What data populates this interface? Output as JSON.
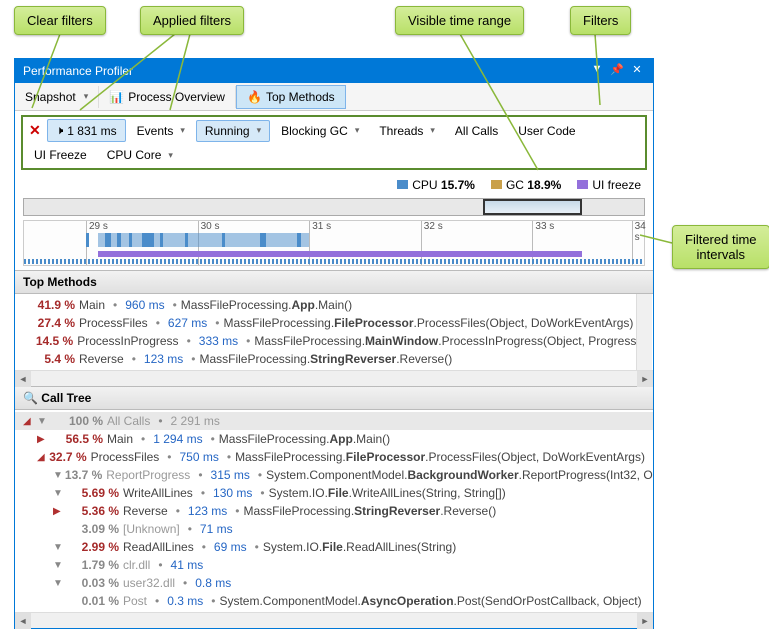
{
  "callouts": {
    "clear_filters": "Clear filters",
    "applied_filters": "Applied filters",
    "visible_time_range": "Visible time range",
    "filters": "Filters",
    "filtered_time_intervals": "Filtered time\nintervals"
  },
  "window": {
    "title": "Performance Profiler"
  },
  "tabs": {
    "snapshot": "Snapshot",
    "process_overview": "Process Overview",
    "top_methods": "Top Methods"
  },
  "filters": {
    "time_ms": "1 831 ms",
    "events": "Events",
    "running": "Running",
    "blocking_gc": "Blocking GC",
    "threads": "Threads",
    "all_calls": "All Calls",
    "user_code": "User Code",
    "ui_freeze": "UI Freeze",
    "cpu_core": "CPU Core"
  },
  "legend": {
    "cpu_label": "CPU",
    "cpu_value": "15.7%",
    "gc_label": "GC",
    "gc_value": "18.9%",
    "ui_freeze": "UI freeze"
  },
  "timeline": {
    "ticks": [
      "29 s",
      "30 s",
      "31 s",
      "32 s",
      "33 s",
      "34 s"
    ]
  },
  "sections": {
    "top_methods": "Top Methods",
    "call_tree": "Call Tree"
  },
  "top_methods": [
    {
      "pct": "41.9 %",
      "name": "Main",
      "ms": "960 ms",
      "path": "MassFileProcessing.<b>App</b>.Main()"
    },
    {
      "pct": "27.4 %",
      "name": "ProcessFiles",
      "ms": "627 ms",
      "path": "MassFileProcessing.<b>FileProcessor</b>.ProcessFiles(Object, DoWorkEventArgs)"
    },
    {
      "pct": "14.5 %",
      "name": "ProcessInProgress",
      "ms": "333 ms",
      "path": "MassFileProcessing.<b>MainWindow</b>.ProcessInProgress(Object, ProgressC"
    },
    {
      "pct": "5.4 %",
      "name": "Reverse",
      "ms": "123 ms",
      "path": "MassFileProcessing.<b>StringReverser</b>.Reverse()"
    }
  ],
  "call_tree_header": {
    "pct": "100 %",
    "label": "All Calls",
    "ms": "2 291 ms"
  },
  "call_tree": [
    {
      "indent": 1,
      "glyph": "▶",
      "glyphRed": true,
      "pct": "56.5 %",
      "name": "Main",
      "ms": "1 294 ms",
      "path": "MassFileProcessing.<b>App</b>.Main()"
    },
    {
      "indent": 1,
      "glyph": "◢",
      "glyphRed": true,
      "pct": "32.7 %",
      "name": "ProcessFiles",
      "ms": "750 ms",
      "path": "MassFileProcessing.<b>FileProcessor</b>.ProcessFiles(Object, DoWorkEventArgs)"
    },
    {
      "indent": 2,
      "glyph": "▼",
      "pct": "13.7 %",
      "gray": true,
      "name": "ReportProgress",
      "ms": "315 ms",
      "path": "System.ComponentModel.<b>BackgroundWorker</b>.ReportProgress(Int32, O"
    },
    {
      "indent": 2,
      "glyph": "▼",
      "pct": "5.69 %",
      "name": "WriteAllLines",
      "ms": "130 ms",
      "path": "System.IO.<b>File</b>.WriteAllLines(String, String[])"
    },
    {
      "indent": 2,
      "glyph": "▶",
      "glyphRed": true,
      "pct": "5.36 %",
      "name": "Reverse",
      "ms": "123 ms",
      "path": "MassFileProcessing.<b>StringReverser</b>.Reverse()"
    },
    {
      "indent": 2,
      "glyph": "",
      "pct": "3.09 %",
      "gray": true,
      "name": "[Unknown]",
      "ms": "71 ms",
      "path": ""
    },
    {
      "indent": 2,
      "glyph": "▼",
      "pct": "2.99 %",
      "name": "ReadAllLines",
      "ms": "69 ms",
      "path": "System.IO.<b>File</b>.ReadAllLines(String)"
    },
    {
      "indent": 2,
      "glyph": "▼",
      "pct": "1.79 %",
      "gray": true,
      "name": "clr.dll",
      "ms": "41 ms",
      "path": ""
    },
    {
      "indent": 2,
      "glyph": "▼",
      "pct": "0.03 %",
      "gray": true,
      "name": "user32.dll",
      "ms": "0.8 ms",
      "path": ""
    },
    {
      "indent": 2,
      "glyph": "",
      "pct": "0.01 %",
      "gray": true,
      "name": "Post",
      "ms": "0.3 ms",
      "path": "System.ComponentModel.<b>AsyncOperation</b>.Post(SendOrPostCallback, Object)"
    }
  ]
}
